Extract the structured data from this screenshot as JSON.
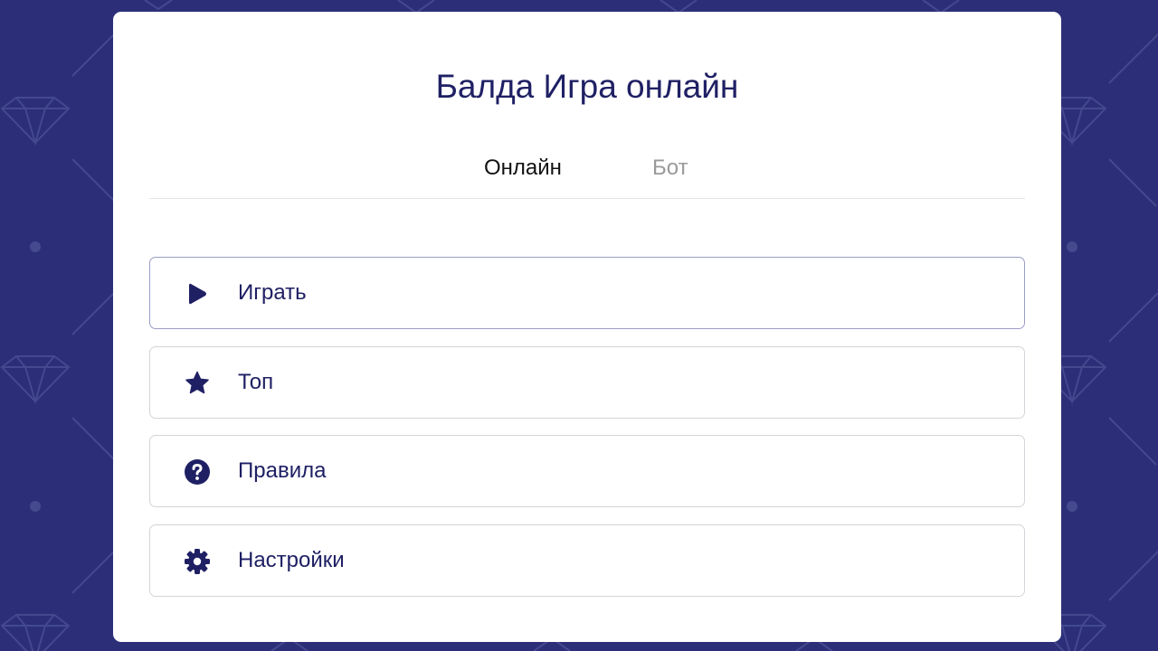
{
  "page": {
    "title": "Балда Игра онлайн"
  },
  "tabs": [
    {
      "label": "Онлайн",
      "active": true
    },
    {
      "label": "Бот",
      "active": false
    }
  ],
  "menu": [
    {
      "label": "Играть",
      "icon": "play-icon"
    },
    {
      "label": "Топ",
      "icon": "star-icon"
    },
    {
      "label": "Правила",
      "icon": "question-circle-icon"
    },
    {
      "label": "Настройки",
      "icon": "gear-icon"
    }
  ],
  "colors": {
    "background": "#2c2f78",
    "card": "#ffffff",
    "accent": "#1f2064",
    "tab_inactive": "#9a9a9a"
  }
}
